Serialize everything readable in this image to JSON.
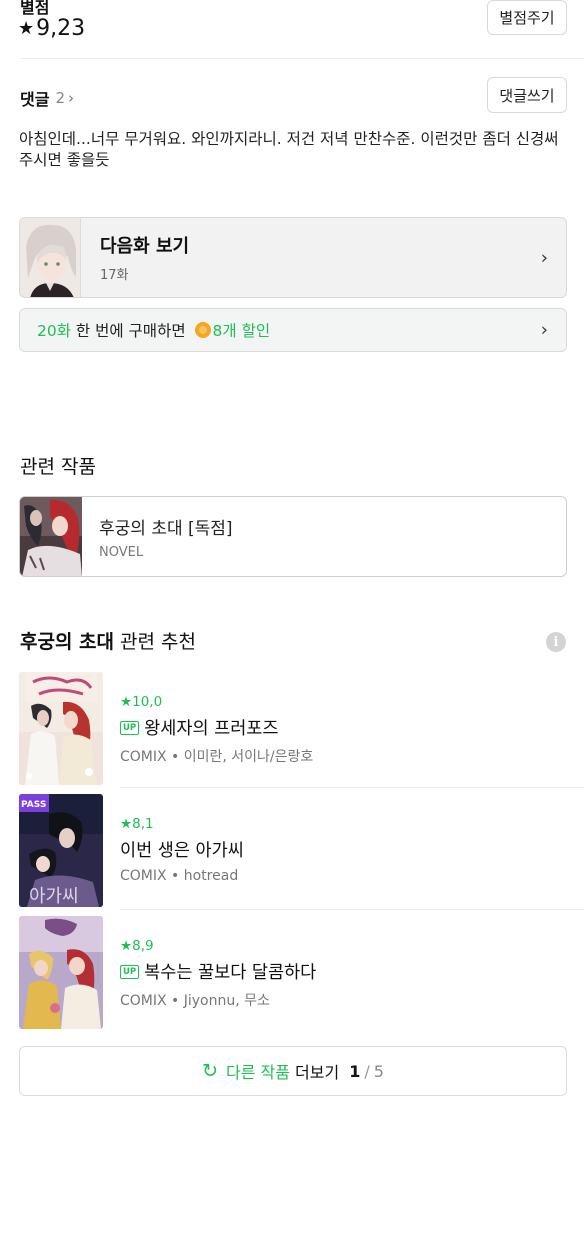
{
  "rating": {
    "label": "별점",
    "star": "★",
    "value": "9,23",
    "rate_button": "별점주기"
  },
  "comments": {
    "title": "댓글",
    "count": "2",
    "chevron": "›",
    "write_button": "댓글쓰기",
    "text": "아침인데...너무 무거워요. 와인까지라니.  저건 저녁 만찬수준. 이런것만 좀더 신경써주시면 좋을듯"
  },
  "next_episode": {
    "title": "다음화 보기",
    "episode": "17화",
    "chevron": "›"
  },
  "bulk_discount": {
    "episodes": "20화",
    "middle_text": " 한 번에 구매하면 ",
    "discount": "8개 할인",
    "chevron": "›"
  },
  "related_works": {
    "section_title": "관련 작품",
    "item": {
      "title": "후궁의 초대 [독점]",
      "category": "NOVEL"
    }
  },
  "recommendations": {
    "title_bold": "후궁의 초대",
    "title_rest": "관련 추천",
    "info_icon_glyph": "i",
    "items": [
      {
        "rating": "★10,0",
        "up": "UP",
        "title": "왕세자의 프러포즈",
        "meta": "COMIX • 이미란, 서이나/은랑호"
      },
      {
        "rating": "★8,1",
        "pass": "PASS",
        "title": "이번 생은 아가씨",
        "meta": "COMIX • hotread"
      },
      {
        "rating": "★8,9",
        "up": "UP",
        "title": "복수는 꿀보다 달콤하다",
        "meta": "COMIX • Jiyonnu, 무소"
      }
    ]
  },
  "more_button": {
    "icon": "↻",
    "label_green": "다른 작품",
    "label_rest": " 더보기",
    "page_current": "1",
    "page_sep": "/",
    "page_total": "5"
  },
  "colors": {
    "accent_green": "#1fbf55",
    "coin": "#f5a623"
  }
}
